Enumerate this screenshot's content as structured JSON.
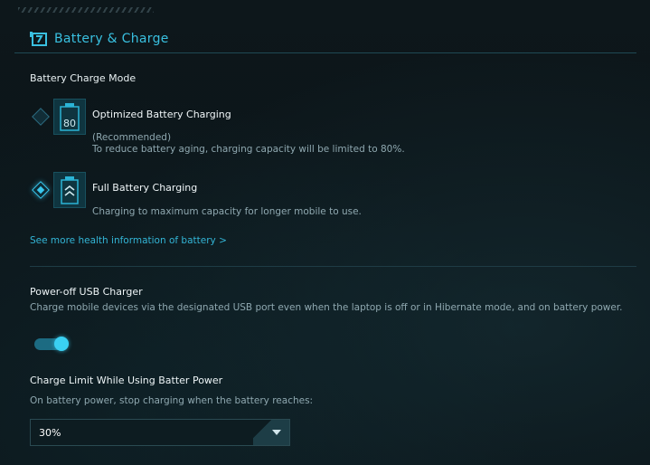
{
  "header": {
    "title": "Battery & Charge"
  },
  "charge_mode": {
    "label": "Battery Charge Mode",
    "options": [
      {
        "title": "Optimized Battery Charging",
        "icon_text": "80",
        "desc_line1": "(Recommended)",
        "desc_line2": "To reduce battery aging, charging capacity will be limited to 80%.",
        "selected": false
      },
      {
        "title": "Full Battery Charging",
        "desc_line1": "Charging to maximum capacity for longer mobile to use.",
        "selected": true
      }
    ],
    "link": "See more health information of battery  >"
  },
  "usb_charger": {
    "title": "Power-off USB Charger",
    "desc": "Charge mobile devices via the designated USB port even when the laptop is off or in Hibernate mode, and on battery power.",
    "enabled": true
  },
  "charge_limit": {
    "title": "Charge Limit While Using Batter Power",
    "desc": "On battery power, stop charging when the battery reaches:",
    "selected_value": "30%"
  },
  "colors": {
    "accent": "#39c0e0",
    "background": "#0c1519"
  }
}
